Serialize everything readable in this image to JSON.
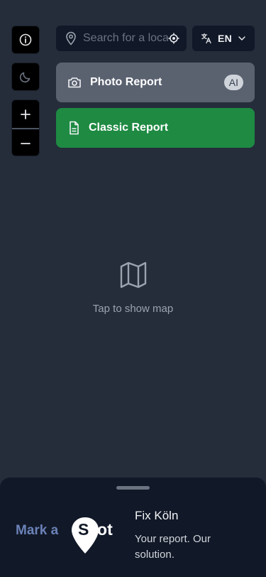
{
  "search": {
    "placeholder": "Search for a location",
    "icon": "map-pin-icon",
    "locate_icon": "crosshair-icon"
  },
  "language": {
    "code": "EN",
    "icon": "translate-icon"
  },
  "controls": {
    "info_icon": "info-icon",
    "theme_icon": "moon-icon",
    "zoom_in_icon": "plus-icon",
    "zoom_out_icon": "minus-icon"
  },
  "reports": {
    "photo": {
      "label": "Photo Report",
      "badge": "AI",
      "icon": "camera-icon",
      "color": "#5a6270"
    },
    "classic": {
      "label": "Classic Report",
      "icon": "document-icon",
      "color": "#1e8a42"
    }
  },
  "map": {
    "hint": "Tap to show map",
    "icon": "map-icon"
  },
  "footer": {
    "logo_text_1": "Mark a",
    "logo_text_2": "Spot",
    "org_name": "Fix Köln",
    "tagline": "Your report. Our solution."
  },
  "colors": {
    "background": "#252d3b",
    "panel": "#111827",
    "logo_accent": "#6b82b8"
  }
}
